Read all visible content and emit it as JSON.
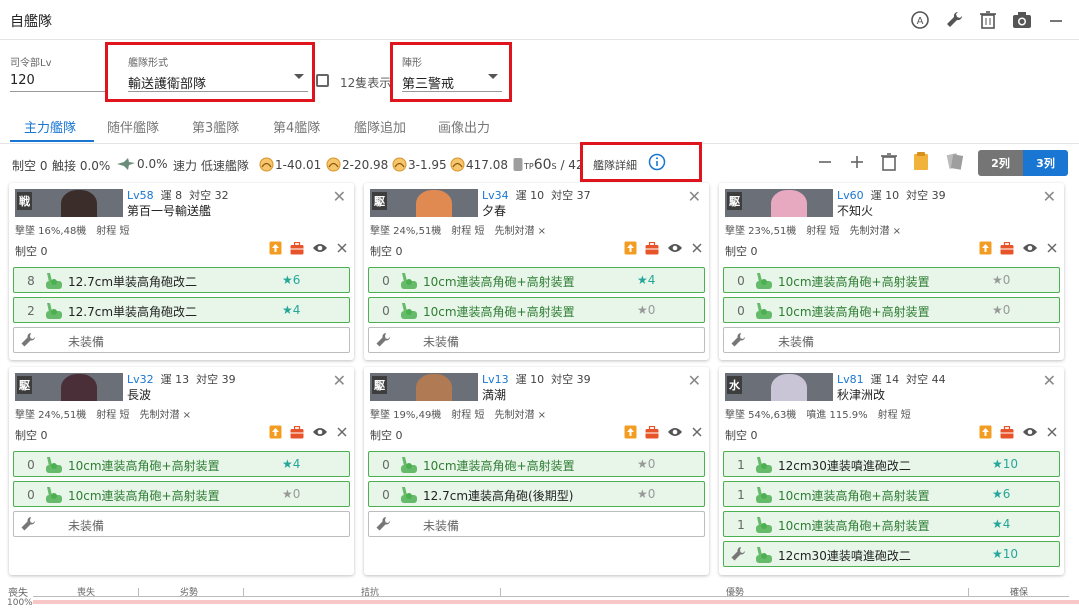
{
  "window": {
    "title": "自艦隊",
    "icons": [
      "auto-icon",
      "wrench-icon",
      "trash-icon",
      "camera-icon",
      "minimize-icon"
    ]
  },
  "settings": {
    "hq_label": "司令部Lv",
    "hq_value": "120",
    "fleet_type_label": "艦隊形式",
    "fleet_type_value": "輸送護衛部隊",
    "twelve_label": "12隻表示",
    "formation_label": "陣形",
    "formation_value": "第三警戒"
  },
  "tabs": [
    "主力艦隊",
    "随伴艦隊",
    "第3艦隊",
    "第4艦隊",
    "艦隊追加",
    "画像出力"
  ],
  "stats": {
    "air": "制空 0",
    "contact": "触接 0.0%",
    "plane_pct": "0.0%",
    "speed": "速力 低速艦隊",
    "f1": "1-40.01",
    "f2": "2-20.98",
    "f3": "3-1.95",
    "f4": "417.08",
    "tp": "60",
    "tp_tail": "/ 42",
    "tp_prefix": "TP",
    "tp_sub": "S",
    "detail_label": "艦隊詳細"
  },
  "layout_buttons": {
    "two": "2列",
    "three": "3列"
  },
  "ships": [
    {
      "lv_prefix": "Lv",
      "lv": "58",
      "luck": "運 8",
      "aa": "対空 32",
      "name": "第百一号輸送艦",
      "sub": "撃墜 16%,48機　射程 短",
      "air": "制空 0",
      "stamp": "戦",
      "face_color": "#3a2d2a",
      "slots": [
        {
          "count": "8",
          "name": "12.7cm単装高角砲改二",
          "star": "★6",
          "lit": true,
          "dark": true
        },
        {
          "count": "2",
          "name": "12.7cm単装高角砲改二",
          "star": "★4",
          "lit": true,
          "dark": true
        }
      ],
      "empty": "未装備"
    },
    {
      "lv_prefix": "Lv",
      "lv": "34",
      "luck": "運 10",
      "aa": "対空 37",
      "name": "夕春",
      "sub": "撃墜 24%,51機　射程 短　先制対潜 ×",
      "air": "制空 0",
      "stamp": "駆",
      "face_color": "#e08a52",
      "slots": [
        {
          "count": "0",
          "name": "10cm連装高角砲+高射装置",
          "star": "★4",
          "lit": true,
          "dark": false
        },
        {
          "count": "0",
          "name": "10cm連装高角砲+高射装置",
          "star": "★0",
          "lit": false,
          "dark": false
        }
      ],
      "empty": "未装備"
    },
    {
      "lv_prefix": "Lv",
      "lv": "60",
      "luck": "運 10",
      "aa": "対空 39",
      "name": "不知火",
      "sub": "撃墜 23%,51機　射程 短　先制対潜 ×",
      "air": "制空 0",
      "stamp": "駆",
      "face_color": "#e7a9c0",
      "slots": [
        {
          "count": "0",
          "name": "10cm連装高角砲+高射装置",
          "star": "★0",
          "lit": false,
          "dark": false
        },
        {
          "count": "0",
          "name": "10cm連装高角砲+高射装置",
          "star": "★0",
          "lit": false,
          "dark": false
        }
      ],
      "empty": "未装備"
    },
    {
      "lv_prefix": "Lv",
      "lv": "32",
      "luck": "運 13",
      "aa": "対空 39",
      "name": "長波",
      "sub": "撃墜 24%,51機　射程 短　先制対潜 ×",
      "air": "制空 0",
      "stamp": "駆",
      "face_color": "#4a2f38",
      "slots": [
        {
          "count": "0",
          "name": "10cm連装高角砲+高射装置",
          "star": "★4",
          "lit": true,
          "dark": false
        },
        {
          "count": "0",
          "name": "10cm連装高角砲+高射装置",
          "star": "★0",
          "lit": false,
          "dark": false
        }
      ],
      "empty": "未装備"
    },
    {
      "lv_prefix": "Lv",
      "lv": "13",
      "luck": "運 10",
      "aa": "対空 39",
      "name": "満潮",
      "sub": "撃墜 19%,49機　射程 短　先制対潜 ×",
      "air": "制空 0",
      "stamp": "駆",
      "face_color": "#b07a55",
      "slots": [
        {
          "count": "0",
          "name": "10cm連装高角砲+高射装置",
          "star": "★0",
          "lit": false,
          "dark": false
        },
        {
          "count": "0",
          "name": "12.7cm連装高角砲(後期型)",
          "star": "★0",
          "lit": false,
          "dark": true
        }
      ],
      "empty": "未装備"
    },
    {
      "lv_prefix": "Lv",
      "lv": "81",
      "luck": "運 14",
      "aa": "対空 44",
      "name": "秋津洲改",
      "sub": "撃墜 54%,63機　噴進 115.9%　射程 短",
      "air": "制空 0",
      "stamp": "水",
      "face_color": "#c9c4d6",
      "slots": [
        {
          "count": "1",
          "name": "12cm30連装噴進砲改二",
          "star": "★10",
          "lit": true,
          "dark": true
        },
        {
          "count": "1",
          "name": "10cm連装高角砲+高射装置",
          "star": "★6",
          "lit": true,
          "dark": false
        },
        {
          "count": "1",
          "name": "10cm連装高角砲+高射装置",
          "star": "★4",
          "lit": true,
          "dark": false
        },
        {
          "count": "",
          "name": "12cm30連装噴進砲改二",
          "star": "★10",
          "lit": true,
          "dark": true,
          "wrench": true
        }
      ],
      "empty": ""
    }
  ],
  "bottom": {
    "lost_label": "喪失",
    "percent": "100%",
    "zones": [
      "喪失",
      "劣勢",
      "拮抗",
      "優勢",
      "確保"
    ],
    "bar_value": 1.0
  },
  "colors": {
    "accent": "#1976d2",
    "highlight": "#e0141c",
    "slot_bg": "#e8f6ea",
    "slot_border": "#4caf50",
    "star": "#26a69a"
  }
}
